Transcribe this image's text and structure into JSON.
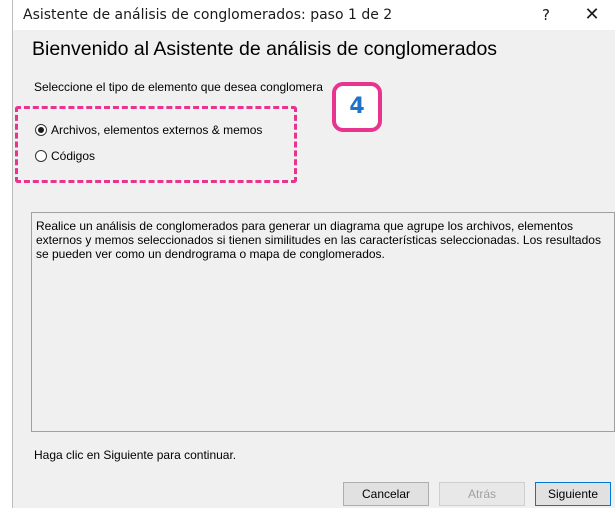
{
  "window": {
    "title": "Asistente de análisis de conglomerados: paso 1 de 2",
    "help_label": "?",
    "close_label": "✕"
  },
  "wizard": {
    "heading": "Bienvenido al Asistente de análisis de conglomerados",
    "prompt": "Seleccione el tipo de elemento que desea conglomera",
    "options": [
      {
        "label": "Archivos, elementos externos & memos",
        "selected": true
      },
      {
        "label": "Códigos",
        "selected": false
      }
    ],
    "description": "Realice un análisis de conglomerados para generar un diagrama que agrupe los archivos, elementos externos y memos seleccionados si tienen similitudes en las características seleccionadas. Los resultados se pueden ver como un dendrograma o mapa de conglomerados.",
    "footer": "Haga clic en Siguiente para continuar."
  },
  "annotation": {
    "step_number": "4",
    "color": "#e8338f",
    "number_color": "#1e73c8"
  },
  "buttons": {
    "cancel": "Cancelar",
    "back": "Atrás",
    "next": "Siguiente"
  },
  "icons": {
    "help": "question-mark",
    "close": "x-close"
  }
}
